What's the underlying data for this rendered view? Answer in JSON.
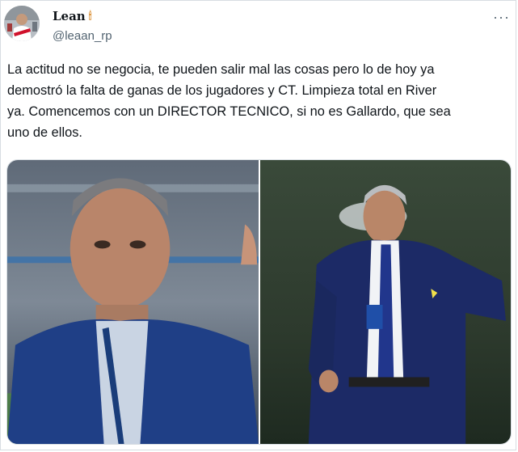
{
  "tweet": {
    "author_name": "Lean",
    "author_emoji": "🕯",
    "handle": "@leaan_rp",
    "more_label": "···",
    "text": "La actitud no se negocia, te pueden salir mal las cosas pero lo de hoy ya\ndemostró la falta de ganas de los jugadores y CT. Limpieza total en River\nya. Comencemos con un DIRECTOR TECNICO, si no es Gallardo, que sea\nuno de ellos."
  },
  "icons": {
    "avatar": "profile-avatar",
    "more": "more-options-icon",
    "photo_left": "photo-coach-stadium",
    "photo_right": "photo-coach-pitch"
  },
  "colors": {
    "text": "#0f1419",
    "secondary": "#536471",
    "border": "#d7dde2"
  }
}
